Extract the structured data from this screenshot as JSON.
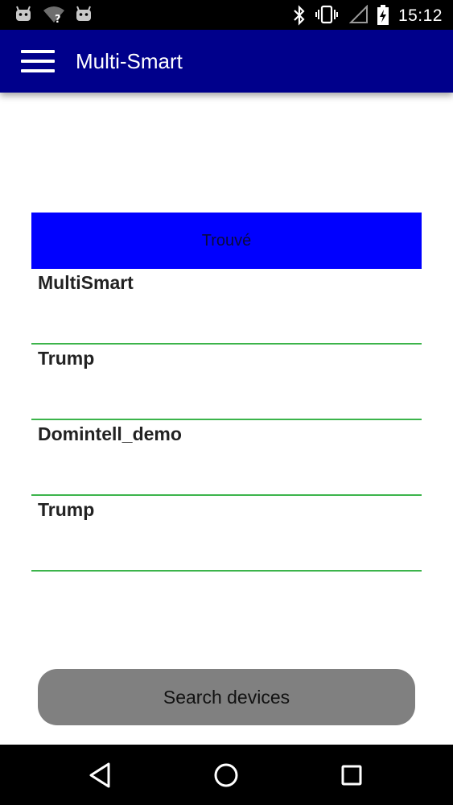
{
  "status_bar": {
    "time": "15:12",
    "left_icons": [
      "android-icon",
      "wifi-unknown-icon",
      "android-icon"
    ],
    "right_icons": [
      "bluetooth-icon",
      "vibrate-icon",
      "signal-icon",
      "battery-charging-icon"
    ]
  },
  "app_bar": {
    "title": "Multi-Smart",
    "menu_icon": "hamburger-menu-icon",
    "color": "#00008b"
  },
  "list": {
    "header": "Trouvé",
    "header_color": "#0000ff",
    "divider_color": "#3cb44b",
    "devices": [
      {
        "name": "MultiSmart"
      },
      {
        "name": "Trump"
      },
      {
        "name": "Domintell_demo"
      },
      {
        "name": "Trump"
      }
    ]
  },
  "search_button": {
    "label": "Search devices",
    "color": "#808080"
  },
  "nav_bar": {
    "buttons": [
      "back-icon",
      "home-icon",
      "recents-icon"
    ]
  }
}
